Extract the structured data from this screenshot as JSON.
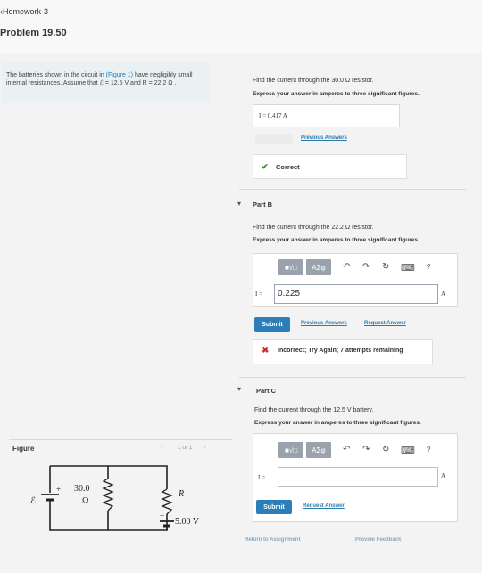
{
  "header": {
    "breadcrumb": "‹Homework-3",
    "problem_title": "Problem 19.50"
  },
  "problem": {
    "text_before": "The batteries shown in the circuit in ",
    "figure_link": "(Figure 1)",
    "text_after": " have negligibly small internal resistances. Assume that ℰ = 12.5 V and R = 22.2 Ω ."
  },
  "partA": {
    "question": "Find the current through the 30.0 Ω resistor.",
    "instruction": "Express your answer in amperes to three significant figures.",
    "answer": "I = 0.417  A",
    "previous_answers": "Previous Answers",
    "feedback": "Correct",
    "feedback_icon": "check-icon"
  },
  "partB": {
    "label": "Part B",
    "question": "Find the current through the 22.2 Ω resistor.",
    "instruction": "Express your answer in amperes to three significant figures.",
    "toolbar": {
      "fraction_sqrt": "■√□",
      "greek": "ΑΣφ",
      "undo": "↶",
      "redo": "↷",
      "reset": "↻",
      "keyboard": "⌨",
      "help": "?"
    },
    "input_label": "I =",
    "input_value": "0.225",
    "unit": "A",
    "submit": "Submit",
    "previous_answers": "Previous Answers",
    "request_answer": "Request Answer",
    "feedback": "Incorrect; Try Again; 7 attempts remaining",
    "feedback_icon": "x-icon"
  },
  "partC": {
    "label": "Part C",
    "question": "Find the current through the 12.5 V battery.",
    "instruction": "Express your answer in amperes to three significant figures.",
    "toolbar": {
      "fraction_sqrt": "■√□",
      "greek": "ΑΣφ",
      "undo": "↶",
      "redo": "↷",
      "reset": "↻",
      "keyboard": "⌨",
      "help": "?"
    },
    "input_label": "I =",
    "input_value": "",
    "unit": "A",
    "submit": "Submit",
    "request_answer": "Request Answer"
  },
  "figure": {
    "title": "Figure",
    "pager": "1 of 1",
    "emf_label": "ℰ",
    "resistor_label": "30.0",
    "resistor_unit": "Ω",
    "r_label": "R",
    "battery2_label": "5.00 V",
    "plus": "+"
  },
  "footer": {
    "return_link": "Return to Assignment",
    "feedback_link": "Provide Feedback"
  },
  "colors": {
    "link": "#2a7ab0",
    "submit": "#2b7eb8",
    "correct": "#2f8f2f",
    "incorrect": "#c93030"
  }
}
